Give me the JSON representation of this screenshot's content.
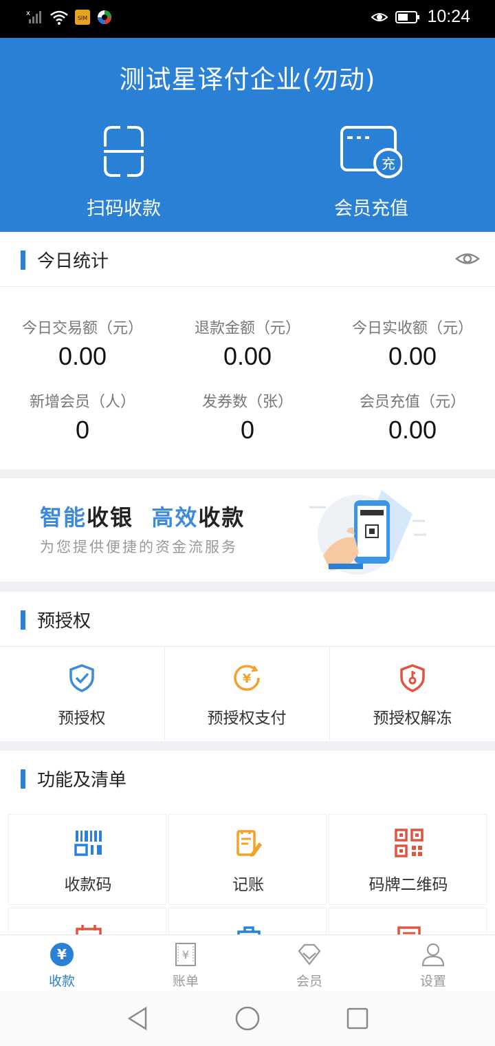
{
  "status_bar": {
    "time": "10:24",
    "sim_label": "SIM"
  },
  "header": {
    "title": "测试星译付企业(勿动)",
    "scan_label": "扫码收款",
    "recharge_label": "会员充值",
    "recharge_icon_badge": "充"
  },
  "today_stats": {
    "title": "今日统计",
    "items": [
      {
        "label": "今日交易额（元）",
        "value": "0.00"
      },
      {
        "label": "退款金额（元）",
        "value": "0.00"
      },
      {
        "label": "今日实收额（元）",
        "value": "0.00"
      },
      {
        "label": "新增会员（人）",
        "value": "0"
      },
      {
        "label": "发券数（张）",
        "value": "0"
      },
      {
        "label": "会员充值（元）",
        "value": "0.00"
      }
    ]
  },
  "banner": {
    "part1_blue": "智能",
    "part1_dark": "收银",
    "part2_blue": "高效",
    "part2_dark": "收款",
    "subtitle": "为您提供便捷的资金流服务"
  },
  "preauth": {
    "title": "预授权",
    "items": [
      {
        "label": "预授权",
        "icon": "shield-check-icon",
        "color": "#3d8ad9"
      },
      {
        "label": "预授权支付",
        "icon": "yuan-coin-icon",
        "color": "#f0a22a"
      },
      {
        "label": "预授权解冻",
        "icon": "shield-key-icon",
        "color": "#e0533f"
      }
    ]
  },
  "functions": {
    "title": "功能及清单",
    "items": [
      {
        "label": "收款码",
        "icon": "barcode-icon",
        "color": "#2a80d4"
      },
      {
        "label": "记账",
        "icon": "notebook-icon",
        "color": "#f0a22a"
      },
      {
        "label": "码牌二维码",
        "icon": "qr-code-icon",
        "color": "#e0533f"
      }
    ]
  },
  "tabbar": {
    "items": [
      {
        "label": "收款",
        "icon": "yuan-circle-icon",
        "active": true
      },
      {
        "label": "账单",
        "icon": "bill-icon",
        "active": false
      },
      {
        "label": "会员",
        "icon": "diamond-icon",
        "active": false
      },
      {
        "label": "设置",
        "icon": "person-icon",
        "active": false
      }
    ]
  },
  "colors": {
    "primary": "#2a80d4",
    "orange": "#f0a22a",
    "red": "#e0533f",
    "inactive": "#999999"
  }
}
